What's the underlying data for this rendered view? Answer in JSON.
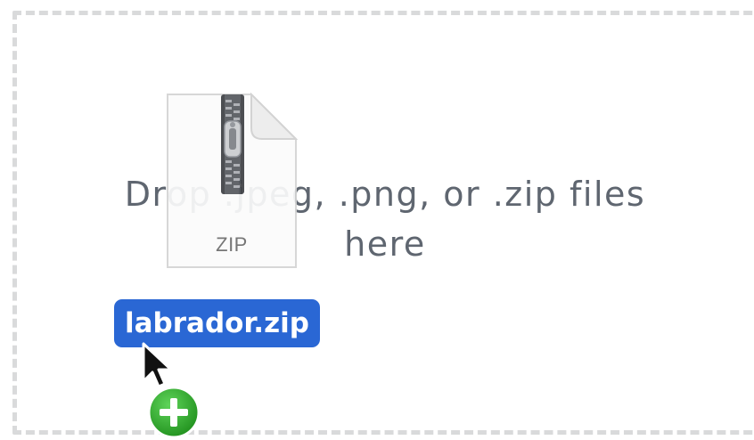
{
  "dropzone": {
    "message": "Drop .jpeg, .png, or .zip files here"
  },
  "drag_item": {
    "file_name": "labrador.zip",
    "icon_caption": "ZIP",
    "icon": "zip-file-icon"
  },
  "cursor": {
    "icon": "arrow-cursor-icon",
    "badge_icon": "copy-plus-icon"
  },
  "colors": {
    "dropzone_border": "#d9dadb",
    "message_text": "#5f6670",
    "selection_label_bg": "#2a67d4",
    "copy_badge_green": "#2fa82a"
  }
}
